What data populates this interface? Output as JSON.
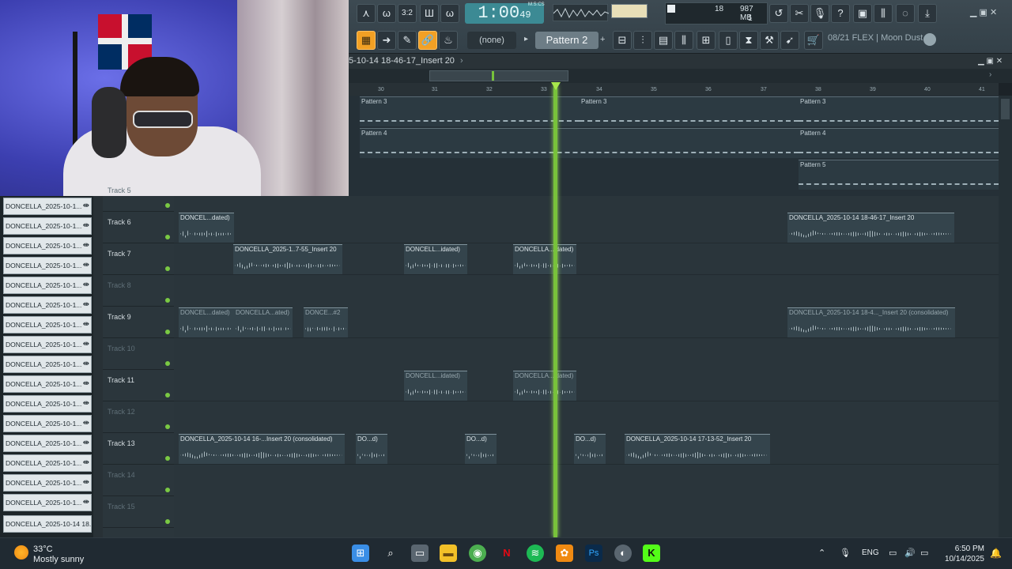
{
  "toolbar": {
    "time": "1:00",
    "time_small": "49",
    "time_unit": "M:S:CS",
    "cpu_value": "18",
    "memory": "987 MB",
    "voices": "1",
    "none_select": "(none)",
    "pattern_select": "Pattern 2",
    "hint": "08/21  FLEX | Moon Dust"
  },
  "playlist": {
    "title": "5-10-14 18-46-17_Insert 20",
    "ruler_ticks": [
      "30",
      "31",
      "32",
      "33",
      "34",
      "35",
      "36",
      "37",
      "38",
      "39",
      "40",
      "41"
    ]
  },
  "pattern_lanes": [
    {
      "label": "Pattern 3"
    },
    {
      "label": "Pattern 3"
    },
    {
      "label": "Pattern 3"
    },
    {
      "label": "Pattern 4"
    },
    {
      "label": "Pattern 4"
    },
    {
      "label": "Pattern 5"
    }
  ],
  "mixer_items": [
    "DONCELLA_2025-10-1...",
    "DONCELLA_2025-10-1...",
    "DONCELLA_2025-10-1...",
    "DONCELLA_2025-10-1...",
    "DONCELLA_2025-10-1...",
    "DONCELLA_2025-10-1...",
    "DONCELLA_2025-10-1...",
    "DONCELLA_2025-10-1...",
    "DONCELLA_2025-10-1...",
    "DONCELLA_2025-10-1...",
    "DONCELLA_2025-10-1...",
    "DONCELLA_2025-10-1...",
    "DONCELLA_2025-10-1...",
    "DONCELLA_2025-10-1...",
    "DONCELLA_2025-10-1...",
    "DONCELLA_2025-10-1...",
    "DONCELLA_2025-10-14 18..."
  ],
  "tracks": [
    {
      "name": "Track 5",
      "dim": true
    },
    {
      "name": "Track 6",
      "dim": false
    },
    {
      "name": "Track 7",
      "dim": false
    },
    {
      "name": "Track 8",
      "dim": true
    },
    {
      "name": "Track 9",
      "dim": false
    },
    {
      "name": "Track 10",
      "dim": true
    },
    {
      "name": "Track 11",
      "dim": false
    },
    {
      "name": "Track 12",
      "dim": true
    },
    {
      "name": "Track 13",
      "dim": false
    },
    {
      "name": "Track 14",
      "dim": true
    },
    {
      "name": "Track 15",
      "dim": true
    }
  ],
  "clips": {
    "t6_a": "DONCEL...dated)",
    "t6_b": "DONCELLA_2025-10-14 18-46-17_Insert 20",
    "t7_a": "DONCELLA_2025-1..7-55_Insert 20",
    "t7_b": "DONCELL...idated)",
    "t7_c": "DONCELLA...idated)",
    "t9_a": "DONCEL...dated)",
    "t9_b": "DONCELLA...ated)",
    "t9_c": "DONCE...#2",
    "t9_d": "DONCELLA_2025-10-14 18-4..._Insert 20 (consolidated)",
    "t11_a": "DONCELL...idated)",
    "t11_b": "DONCELLA...idated)",
    "t13_a": "DONCELLA_2025-10-14 16-...Insert 20 (consolidated)",
    "t13_b": "DO...d)",
    "t13_c": "DO...d)",
    "t13_d": "DO...d)",
    "t13_e": "DONCELLA_2025-10-14 17-13-52_Insert 20"
  },
  "taskbar": {
    "temp": "33°C",
    "weather": "Mostly sunny",
    "lang": "ENG",
    "time": "6:50 PM",
    "date": "10/14/2025"
  },
  "colors": {
    "playhead": "#78c23b",
    "accent_orange": "#f2a024",
    "time_display": "#3c8a94"
  }
}
